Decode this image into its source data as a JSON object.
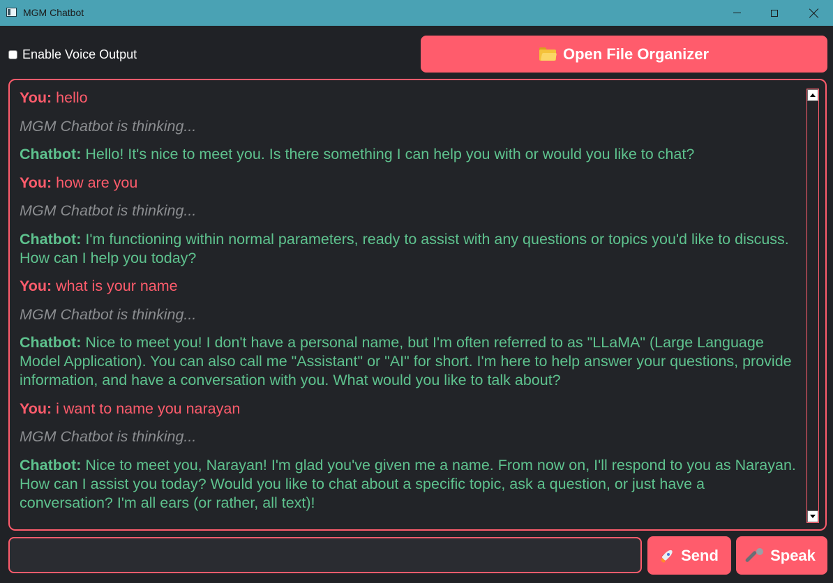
{
  "window": {
    "title": "MGM Chatbot"
  },
  "toolbar": {
    "voice_label": "Enable Voice Output",
    "voice_checked": false,
    "organizer_label": "Open File Organizer",
    "organizer_icon": "folder-icon"
  },
  "chat": {
    "messages": [
      {
        "role": "user",
        "label": "You:",
        "text": "hello"
      },
      {
        "role": "thinking",
        "text": "MGM Chatbot is thinking..."
      },
      {
        "role": "bot",
        "label": "Chatbot:",
        "text": "Hello! It's nice to meet you. Is there something I can help you with or would you like to chat?"
      },
      {
        "role": "user",
        "label": "You:",
        "text": "how are you"
      },
      {
        "role": "thinking",
        "text": "MGM Chatbot is thinking..."
      },
      {
        "role": "bot",
        "label": "Chatbot:",
        "text": "I'm functioning within normal parameters, ready to assist with any questions or topics you'd like to discuss. How can I help you today?"
      },
      {
        "role": "user",
        "label": "You:",
        "text": "what is your name"
      },
      {
        "role": "thinking",
        "text": "MGM Chatbot is thinking..."
      },
      {
        "role": "bot",
        "label": "Chatbot:",
        "text": "Nice to meet you! I don't have a personal name, but I'm often referred to as \"LLaMA\" (Large Language Model Application). You can also call me \"Assistant\" or \"AI\" for short. I'm here to help answer your questions, provide information, and have a conversation with you. What would you like to talk about?"
      },
      {
        "role": "user",
        "label": "You:",
        "text": "i want to name you narayan"
      },
      {
        "role": "thinking",
        "text": "MGM Chatbot is thinking..."
      },
      {
        "role": "bot",
        "label": "Chatbot:",
        "text": "Nice to meet you, Narayan! I'm glad you've given me a name. From now on, I'll respond to you as Narayan. How can I assist you today? Would you like to chat about a specific topic, ask a question, or just have a conversation? I'm all ears (or rather, all text)!"
      }
    ]
  },
  "input": {
    "value": "",
    "placeholder": ""
  },
  "actions": {
    "send_label": "Send",
    "send_icon": "rocket-icon",
    "speak_label": "Speak",
    "speak_icon": "microphone-icon"
  },
  "colors": {
    "accent": "#ff5c6c",
    "bot_text": "#5ec28e",
    "thinking_text": "#8b8d90",
    "background": "#202226",
    "titlebar": "#4aa2b4"
  }
}
